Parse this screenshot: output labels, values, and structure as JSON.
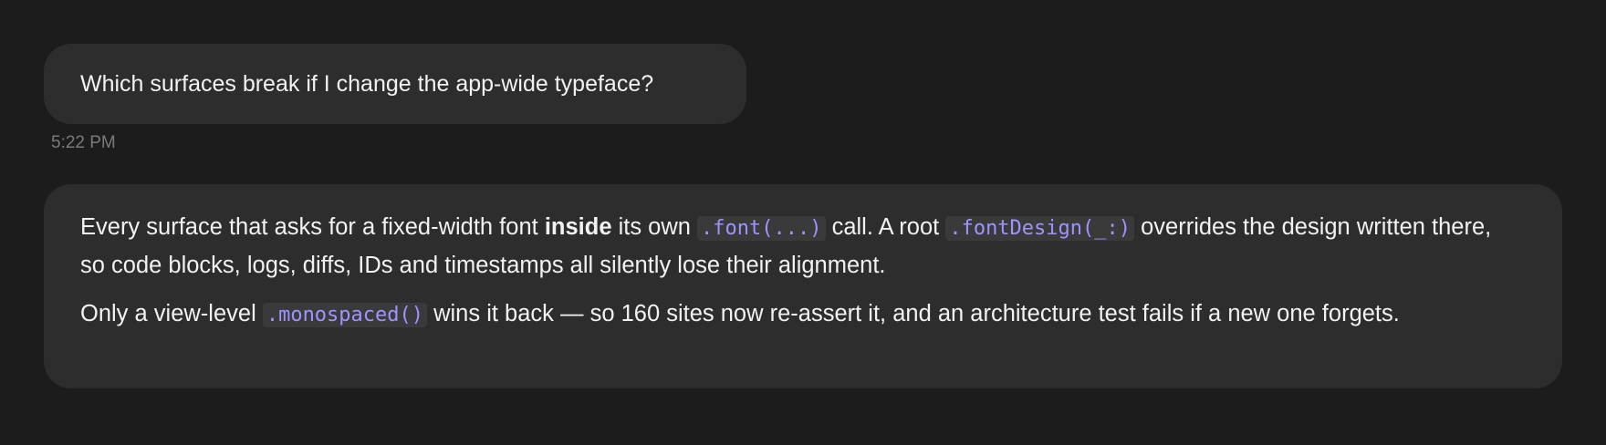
{
  "user_message": {
    "text": "Which surfaces break if I change the app-wide typeface?",
    "timestamp": "5:22 PM"
  },
  "assistant_message": {
    "p1": {
      "t1": "Every surface that asks for a fixed-width font ",
      "bold": "inside",
      "t2": " its own ",
      "code1": ".font(...)",
      "t3": " call. A root ",
      "code2": ".fontDesign(_:)",
      "t4": " overrides the design written there, so code blocks, logs, diffs, IDs and timestamps all silently lose their alignment."
    },
    "p2": {
      "t1": "Only a view-level ",
      "code1": ".monospaced()",
      "t2": " wins it back — so 160 sites now re-assert it, and an architecture test fails if a new one forgets."
    }
  },
  "colors": {
    "background": "#1c1c1c",
    "bubble": "#2d2d2d",
    "code_text": "#9d94ff",
    "code_background": "#3a3a3a",
    "timestamp": "#7a7a7a"
  }
}
